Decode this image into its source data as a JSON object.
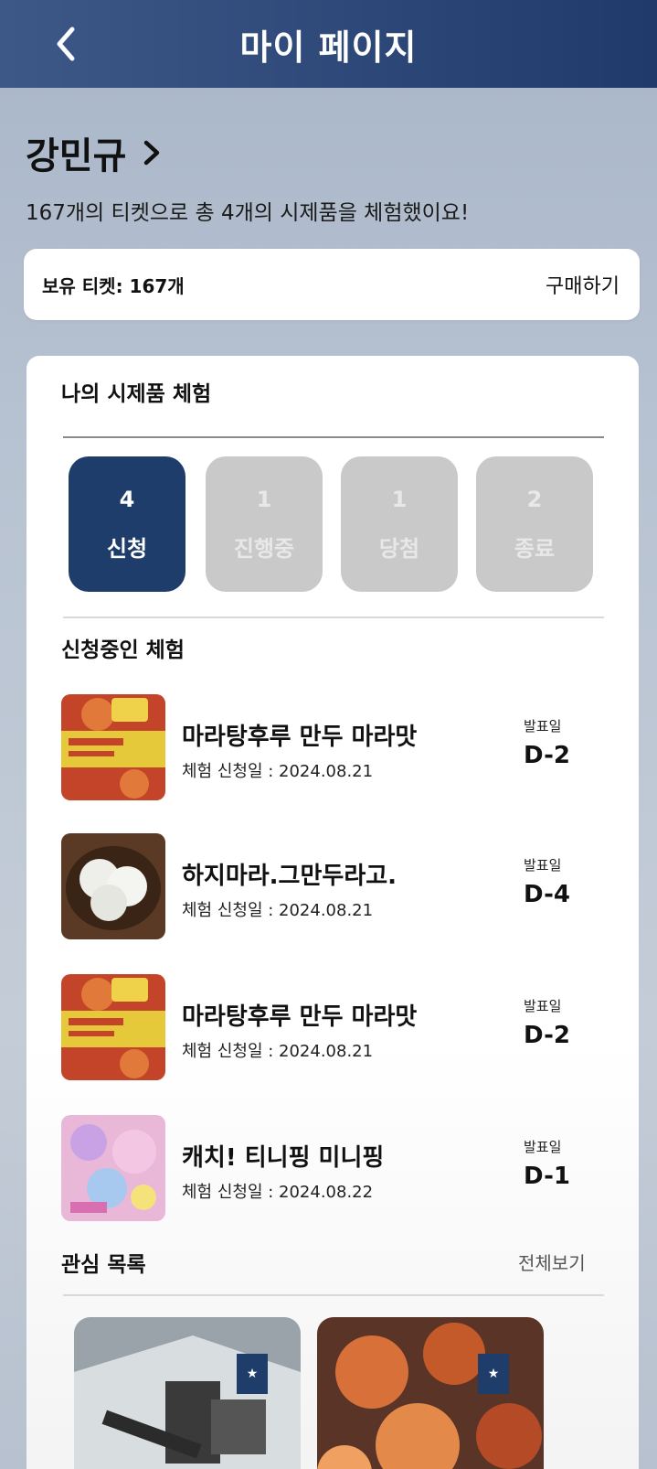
{
  "header": {
    "title": "마이 페이지"
  },
  "profile": {
    "name": "강민규",
    "summary": "167개의 티켓으로 총 4개의 시제품을 체험했이요!"
  },
  "tickets": {
    "label": "보유 티켓: 167개",
    "buy_label": "구매하기"
  },
  "experience": {
    "title": "나의 시제품 체험",
    "tabs": [
      {
        "count": "4",
        "label": "신청"
      },
      {
        "count": "1",
        "label": "진행중"
      },
      {
        "count": "1",
        "label": "당첨"
      },
      {
        "count": "2",
        "label": "종료"
      }
    ],
    "applied_title": "신청중인 체험",
    "items": [
      {
        "title": "마라탕후루 만두 마라맛",
        "date": "체험 신청일 : 2024.08.21",
        "announce_label": "발표일",
        "dday": "D-2"
      },
      {
        "title": "하지마라.그만두라고.",
        "date": "체험 신청일 : 2024.08.21",
        "announce_label": "발표일",
        "dday": "D-4"
      },
      {
        "title": "마라탕후루 만두 마라맛",
        "date": "체험 신청일 : 2024.08.21",
        "announce_label": "발표일",
        "dday": "D-2"
      },
      {
        "title": "캐치! 티니핑 미니핑",
        "date": "체험 신청일 : 2024.08.22",
        "announce_label": "발표일",
        "dday": "D-1"
      }
    ]
  },
  "wishlist": {
    "title": "관심 목록",
    "view_all": "전체보기"
  },
  "colors": {
    "primary": "#1f3d6b",
    "inactive_tab": "#c9c9c9"
  },
  "icons": {
    "back": "chevron-left-icon",
    "profile": "chevron-right-icon",
    "bookmark": "bookmark-star-icon"
  }
}
